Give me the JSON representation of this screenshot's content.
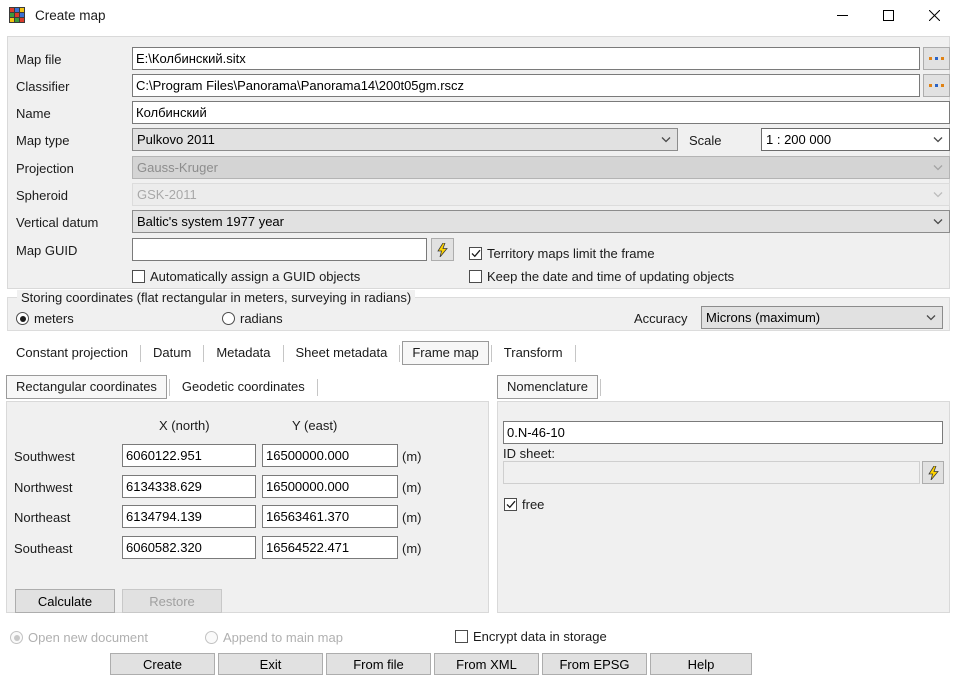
{
  "window": {
    "title": "Create map",
    "icon": "map-grid-icon",
    "controls": {
      "minimize": "minimize-icon",
      "maximize": "maximize-icon",
      "close": "close-icon"
    }
  },
  "form": {
    "rows": [
      {
        "label": "Map file",
        "value": "E:\\Колбинский.sitx",
        "kind": "text"
      },
      {
        "label": "Classifier",
        "value": "C:\\Program Files\\Panorama\\Panorama14\\200t05gm.rscz",
        "kind": "text"
      },
      {
        "label": "Name",
        "value": "Колбинский",
        "kind": "text"
      },
      {
        "label": "Map type",
        "value": "Pulkovo 2011",
        "kind": "combo"
      },
      {
        "label": "Projection",
        "value": "Gauss-Kruger",
        "kind": "combo-disabled"
      },
      {
        "label": "Spheroid",
        "value": "GSK-2011",
        "kind": "combo-disabled2"
      },
      {
        "label": "Vertical datum",
        "value": "Baltic's system 1977 year",
        "kind": "combo"
      },
      {
        "label": "Map GUID",
        "value": "",
        "kind": "text"
      }
    ],
    "browse_button": "...",
    "scale_label": "Scale",
    "scale_value": "1 : 200 000",
    "guid_generate_icon": "lightning-bolt-icon",
    "checkboxes": {
      "auto_guid": {
        "label": "Automatically assign a GUID objects",
        "checked": false
      },
      "territory_limit": {
        "label": "Territory maps limit the frame",
        "checked": true
      },
      "keep_date": {
        "label": "Keep the date and time of updating objects",
        "checked": false
      }
    }
  },
  "storing": {
    "title": "Storing coordinates (flat rectangular in meters, surveying in radians)",
    "options": [
      {
        "label": "meters",
        "selected": true
      },
      {
        "label": "radians",
        "selected": false
      }
    ],
    "accuracy_label": "Accuracy",
    "accuracy_value": "Microns (maximum)"
  },
  "tabs_main": {
    "items": [
      "Constant projection",
      "Datum",
      "Metadata",
      "Sheet metadata",
      "Frame map",
      "Transform"
    ],
    "selected": "Frame map"
  },
  "tabs_left": {
    "items": [
      "Rectangular coordinates",
      "Geodetic coordinates"
    ],
    "selected": "Rectangular coordinates"
  },
  "tabs_right": {
    "items": [
      "Nomenclature"
    ],
    "selected": "Nomenclature"
  },
  "frame_map": {
    "headers": {
      "x": "X (north)",
      "y": "Y (east)"
    },
    "unit": "(m)",
    "rows": [
      {
        "corner": "Southwest",
        "x": "6060122.951",
        "y": "16500000.000"
      },
      {
        "corner": "Northwest",
        "x": "6134338.629",
        "y": "16500000.000"
      },
      {
        "corner": "Northeast",
        "x": "6134794.139",
        "y": "16563461.370"
      },
      {
        "corner": "Southeast",
        "x": "6060582.320",
        "y": "16564522.471"
      }
    ],
    "calculate_label": "Calculate",
    "restore_label": "Restore"
  },
  "nomenclature": {
    "value": "0.N-46-10",
    "id_sheet_label": "ID sheet:",
    "id_sheet_value": "",
    "generate_icon": "lightning-bolt-icon",
    "free": {
      "label": "free",
      "checked": true
    }
  },
  "footer": {
    "radios": [
      {
        "label": "Open new document",
        "selected": true,
        "disabled": true
      },
      {
        "label": "Append to main map",
        "selected": false,
        "disabled": true
      }
    ],
    "encrypt": {
      "label": "Encrypt data in storage",
      "checked": false
    },
    "buttons": [
      "Create",
      "Exit",
      "From file",
      "From XML",
      "From EPSG",
      "Help"
    ]
  },
  "colors": {
    "panel": "#f0f0f0",
    "field": "#ffffff",
    "combo": "#e1e1e1",
    "border": "#7a7a7a",
    "disabled_text": "#9a9a9a",
    "accent_bolt": "#ffd400"
  }
}
